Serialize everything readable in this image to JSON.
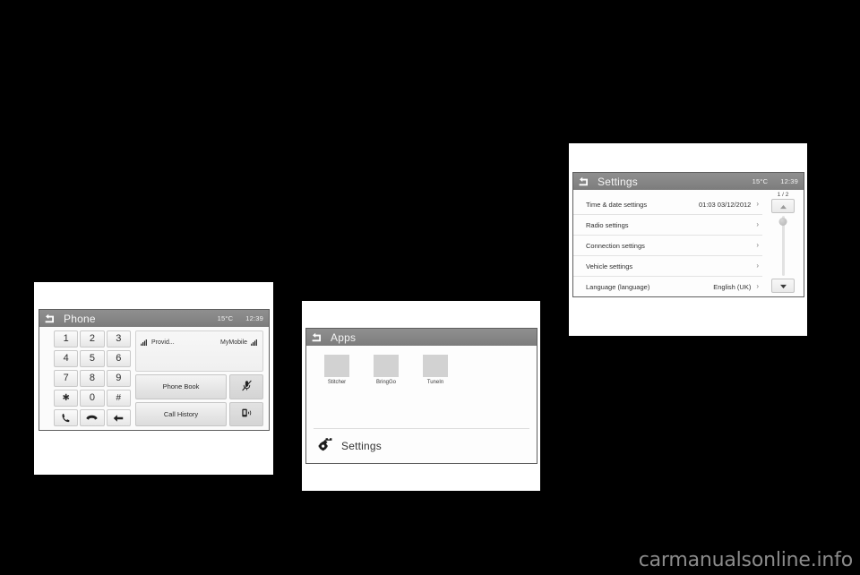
{
  "watermark": {
    "text": "carmanualsonline.info"
  },
  "phone_screen": {
    "title": "Phone",
    "back_icon": "back-arrow-icon",
    "temperature": "15°C",
    "clock": "12:39",
    "keypad": [
      [
        "1",
        "2",
        "3"
      ],
      [
        "4",
        "5",
        "6"
      ],
      [
        "7",
        "8",
        "9"
      ],
      [
        "✱",
        "0",
        "#"
      ]
    ],
    "action_keys": [
      {
        "name": "call-button",
        "icon": "phone-handset-icon"
      },
      {
        "name": "end-call-button",
        "icon": "phone-hangup-icon"
      },
      {
        "name": "backspace-button",
        "icon": "backspace-arrow-icon"
      }
    ],
    "status": {
      "signal_icon_left": "signal-bars-icon",
      "provider": "Provid...",
      "device": "MyMobile",
      "signal_icon_right": "signal-bars-icon"
    },
    "buttons": {
      "phone_book": "Phone Book",
      "call_history": "Call History",
      "mute_icon": "microphone-muted-icon",
      "handset_icon": "phone-speaker-icon"
    }
  },
  "apps_screen": {
    "title": "Apps",
    "back_icon": "back-arrow-icon",
    "apps": [
      {
        "label": "Stitcher",
        "icon": "app-tile-icon"
      },
      {
        "label": "BringGo",
        "icon": "app-tile-icon"
      },
      {
        "label": "TuneIn",
        "icon": "app-tile-icon"
      }
    ],
    "settings_row": {
      "label": "Settings",
      "icon": "gear-wrench-icon"
    }
  },
  "settings_screen": {
    "title": "Settings",
    "back_icon": "back-arrow-icon",
    "temperature": "15°C",
    "clock": "12:39",
    "page_indicator": "1 / 2",
    "rows": [
      {
        "name": "Time & date settings",
        "value": "01:03  03/12/2012",
        "chevron": "›"
      },
      {
        "name": "Radio settings",
        "value": "",
        "chevron": "›"
      },
      {
        "name": "Connection settings",
        "value": "",
        "chevron": "›"
      },
      {
        "name": "Vehicle settings",
        "value": "",
        "chevron": "›"
      },
      {
        "name": "Language (language)",
        "value": "English (UK)",
        "chevron": "›"
      }
    ],
    "scroll": {
      "up_icon": "chevron-up-icon",
      "down_icon": "chevron-down-icon"
    }
  },
  "colors": {
    "background": "#000000",
    "plate": "#ffffff",
    "titlebar": "#868686",
    "screen": "#fdfdfd",
    "tile": "#d2d2d2",
    "watermark": "#8b8b8b"
  }
}
